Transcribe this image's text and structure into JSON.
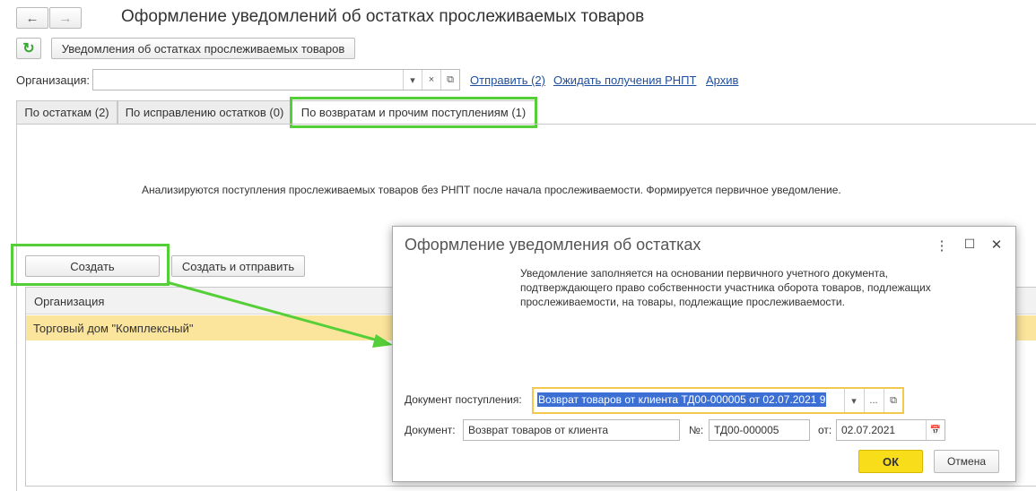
{
  "window": {
    "title": "Оформление уведомлений об остатках прослеживаемых товаров",
    "back_icon": "←",
    "forward_icon": "→"
  },
  "toolbar": {
    "refresh_icon": "↻",
    "notifications_button": "Уведомления об остатках прослеживаемых товаров"
  },
  "organization": {
    "label": "Организация:",
    "value": "",
    "dropdown_icon": "▾",
    "clear_icon": "×",
    "open_icon": "⧉"
  },
  "links": {
    "send": "Отправить (2)",
    "await": "Ожидать получения РНПТ",
    "archive": "Архив"
  },
  "tabs": [
    {
      "label": "По остаткам (2)"
    },
    {
      "label": "По исправлению остатков (0)"
    },
    {
      "label": "По возвратам и прочим поступлениям (1)"
    }
  ],
  "main": {
    "info_text": "Анализируются поступления прослеживаемых товаров без РНПТ после начала прослеживаемости. Формируется первичное уведомление.",
    "create_button": "Создать",
    "create_send_button": "Создать и отправить",
    "table": {
      "header": "Организация",
      "rows": [
        "Торговый дом \"Комплексный\""
      ]
    }
  },
  "dialog": {
    "title": "Оформление уведомления об остатках",
    "menu_icon": "⋮",
    "maximize_icon": "☐",
    "close_icon": "✕",
    "description_lines": [
      "Уведомление заполняется на основании первичного учетного документа,",
      "подтверждающего право собственности участника оборота товаров, подлежащих",
      "прослеживаемости, на товары, подлежащие прослеживаемости."
    ],
    "receipt_doc_label": "Документ поступления:",
    "receipt_doc_value": "Возврат товаров от клиента ТД00-000005 от 02.07.2021 9",
    "receipt_dropdown_icon": "▾",
    "receipt_select_icon": "...",
    "receipt_open_icon": "⧉",
    "doc_label": "Документ:",
    "doc_value": "Возврат товаров от клиента",
    "number_label": "№:",
    "number_value": "ТД00-000005",
    "date_label": "от:",
    "date_value": "02.07.2021",
    "calendar_icon": "📅",
    "ok_button": "ОК",
    "cancel_button": "Отмена"
  },
  "colors": {
    "highlight_green": "#55cf38",
    "row_selected": "#fbe49b",
    "ok_yellow": "#f7dd1a",
    "link_blue": "#1f4e9c"
  }
}
